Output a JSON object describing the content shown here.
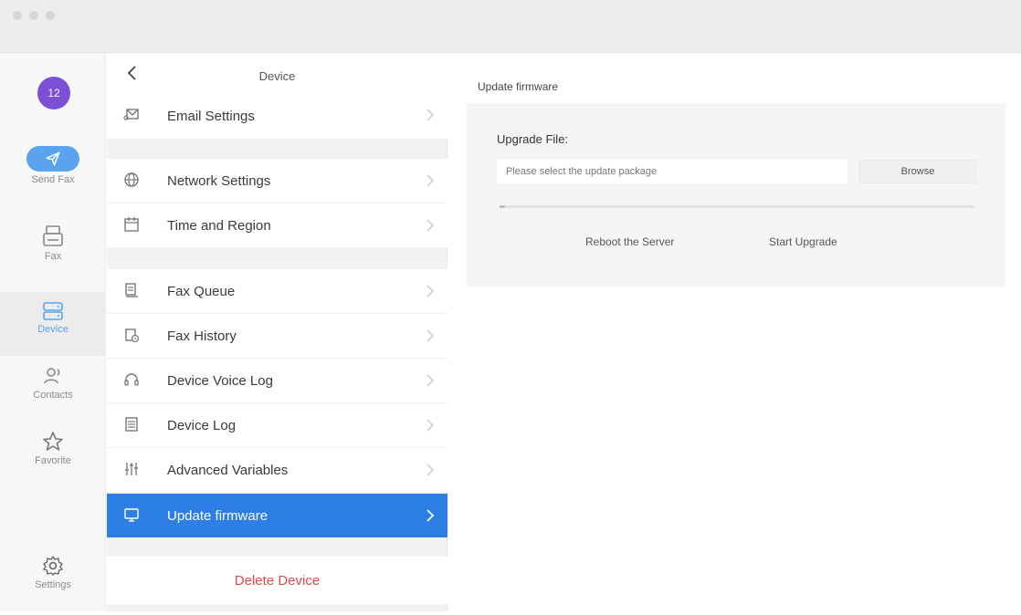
{
  "window": {
    "title": ""
  },
  "user": {
    "avatar_text": "12",
    "avatar_color": "#7b4fd6"
  },
  "rail": {
    "items": [
      {
        "label": "Send Fax",
        "icon": "paper-plane-icon",
        "active": false
      },
      {
        "label": "Fax",
        "icon": "fax-machine-icon",
        "active": false
      },
      {
        "label": "Device",
        "icon": "device-icon",
        "active": true
      },
      {
        "label": "Contacts",
        "icon": "contacts-icon",
        "active": false
      },
      {
        "label": "Favorite",
        "icon": "star-icon",
        "active": false
      }
    ],
    "settings": {
      "label": "Settings",
      "icon": "gear-icon"
    }
  },
  "device_menu": {
    "title": "Device",
    "groups": [
      [
        {
          "label": "Email Settings",
          "icon": "email-settings-icon"
        }
      ],
      [
        {
          "label": "Network Settings",
          "icon": "globe-icon"
        },
        {
          "label": "Time and Region",
          "icon": "calendar-icon"
        }
      ],
      [
        {
          "label": "Fax Queue",
          "icon": "fax-queue-icon"
        },
        {
          "label": "Fax History",
          "icon": "fax-history-icon"
        },
        {
          "label": "Device Voice Log",
          "icon": "headset-icon"
        },
        {
          "label": "Device Log",
          "icon": "log-icon"
        },
        {
          "label": "Advanced Variables",
          "icon": "sliders-icon"
        },
        {
          "label": "Update firmware",
          "icon": "monitor-icon",
          "selected": true
        }
      ]
    ],
    "delete_label": "Delete Device"
  },
  "firmware": {
    "title": "Update firmware",
    "upload_label": "Upgrade File:",
    "file_placeholder": "Please select the update package",
    "file_value": "",
    "browse_label": "Browse",
    "progress": 0.01,
    "reboot_label": "Reboot the Server",
    "start_label": "Start Upgrade"
  },
  "colors": {
    "accent": "#2d7fe6",
    "send_fax": "#5aa3ee",
    "danger": "#e24a4a"
  }
}
